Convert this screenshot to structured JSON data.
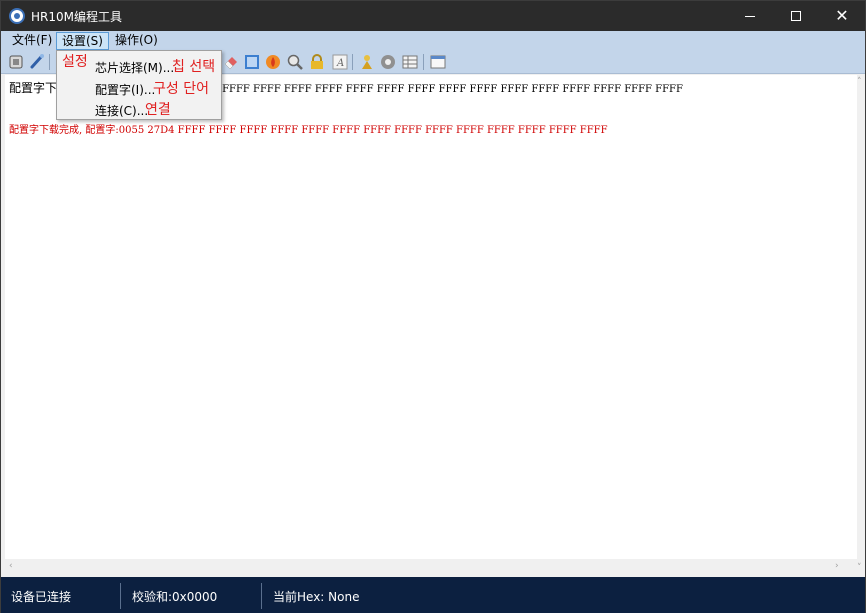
{
  "window": {
    "title": "HR10M编程工具"
  },
  "menubar": {
    "items": [
      {
        "label": "文件(F)"
      },
      {
        "label": "设置(S)"
      },
      {
        "label": "操作(O)"
      }
    ]
  },
  "dropdown": {
    "title_annotation": "설정",
    "items": [
      {
        "label": "芯片选择(M)...",
        "annotation": "칩 선택"
      },
      {
        "label": "配置字(I)...",
        "annotation": "구성 단어"
      },
      {
        "label": "连接(C)...",
        "annotation": "연결"
      }
    ]
  },
  "toolbar": {
    "buttons": [
      {
        "icon": "chip-icon"
      },
      {
        "icon": "probe-icon"
      },
      {
        "icon": "eraser-icon"
      },
      {
        "icon": "blank-check-icon"
      },
      {
        "icon": "burn-icon"
      },
      {
        "icon": "verify-icon"
      },
      {
        "icon": "lock-icon"
      },
      {
        "icon": "config-text-icon"
      },
      {
        "icon": "auto-icon"
      },
      {
        "icon": "settings-icon"
      },
      {
        "icon": "table-icon"
      },
      {
        "icon": "window-icon"
      }
    ]
  },
  "log": {
    "line1_prefix": "配置字下",
    "line1_rest": "FF FFFF FFFF FFFF FFFF FFFF FFFF FFFF FFFF FFFF FFFF FFFF FFFF FFFF FFFF FFFF",
    "line2": "配置字下载完成, 配置字:0055 27D4 FFFF FFFF FFFF FFFF FFFF FFFF FFFF FFFF FFFF FFFF FFFF FFFF FFFF FFFF"
  },
  "status": {
    "connection": "设备已连接",
    "checksum": "校验和:0x0000",
    "current_hex": "当前Hex: None"
  },
  "colors": {
    "titlebar": "#2b2b2b",
    "menubar": "#c3d5ea",
    "statusbar": "#0c2040",
    "log_error": "#d00000",
    "annotation": "#e02020"
  }
}
